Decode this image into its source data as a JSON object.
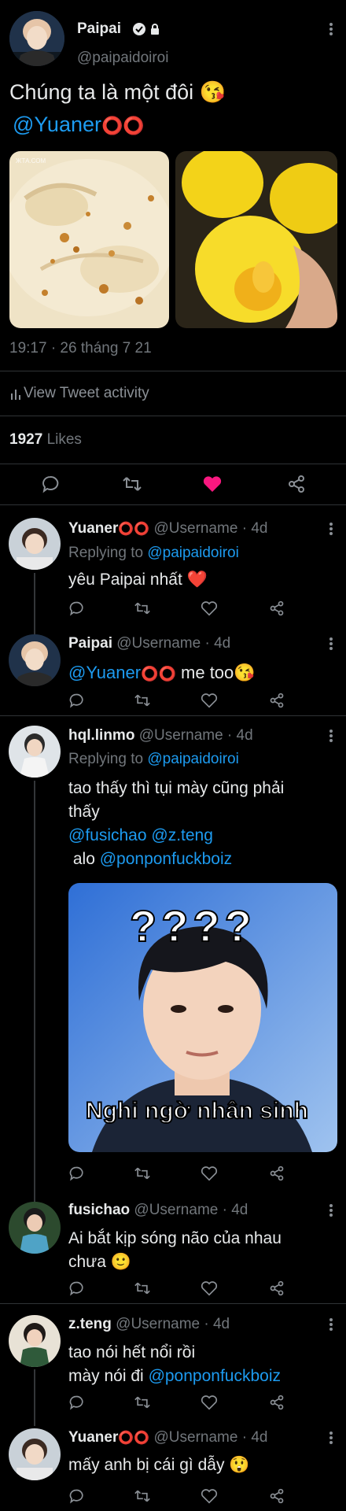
{
  "main_tweet": {
    "author_name": "Paipai",
    "author_handle": "@paipaidoiroi",
    "text": "Chúng ta là một đôi",
    "emoji": "😘",
    "mention": "@Yuaner",
    "mention_circles": "⭕⭕",
    "image_watermark": "ЖТА.СОМ",
    "timestamp": "19:17 · 26 tháng 7 21",
    "activity_label": "View Tweet activity",
    "likes_count": "1927",
    "likes_label": "Likes"
  },
  "replies": [
    {
      "name": "Yuaner",
      "name_suffix": "⭕⭕",
      "meta": "@Username · 4d",
      "replying_prefix": "Replying to",
      "replying_handle": "@paipaidoiroi",
      "text": "yêu Paipai nhất",
      "emoji": "❤️"
    },
    {
      "name": "Paipai",
      "meta": "@Username · 4d",
      "mention": "@Yuaner",
      "mention_circles": "⭕⭕",
      "text": "me too",
      "emoji": "😘"
    },
    {
      "name": "hql.linmo",
      "meta": "@Username · 4d",
      "replying_prefix": "Replying to",
      "replying_handle": "@paipaidoiroi",
      "text_line1": "tao thấy thì tụi mày cũng phải",
      "text_line2": "thấy",
      "mention1": "@fusichao",
      "mention2": "@z.teng",
      "alo_prefix": "alo",
      "mention3": "@ponponfuckboiz",
      "image_question": "????",
      "image_caption": "Nghi ngờ nhân sinh"
    },
    {
      "name": "fusichao",
      "meta": "@Username · 4d",
      "text_line1": "Ai bắt kịp sóng não của nhau",
      "text_line2": "chưa",
      "emoji": "🙂"
    },
    {
      "name": "z.teng",
      "meta": "@Username · 4d",
      "text_line1": "tao nói hết nổi rồi",
      "text_line2_prefix": "mày nói đi",
      "mention": "@ponponfuckboiz"
    },
    {
      "name": "Yuaner",
      "name_suffix": "⭕⭕",
      "meta": "@Username · 4d",
      "text": "mấy anh bị cái gì dẫy",
      "emoji": "😲"
    }
  ],
  "colors": {
    "background": "#000000",
    "link": "#1d9bf0",
    "like_active": "#f91880",
    "muted": "#71767b"
  },
  "icons": [
    "reply-icon",
    "retweet-icon",
    "like-icon",
    "share-icon",
    "verified-icon",
    "lock-icon",
    "more-icon",
    "activity-icon"
  ]
}
